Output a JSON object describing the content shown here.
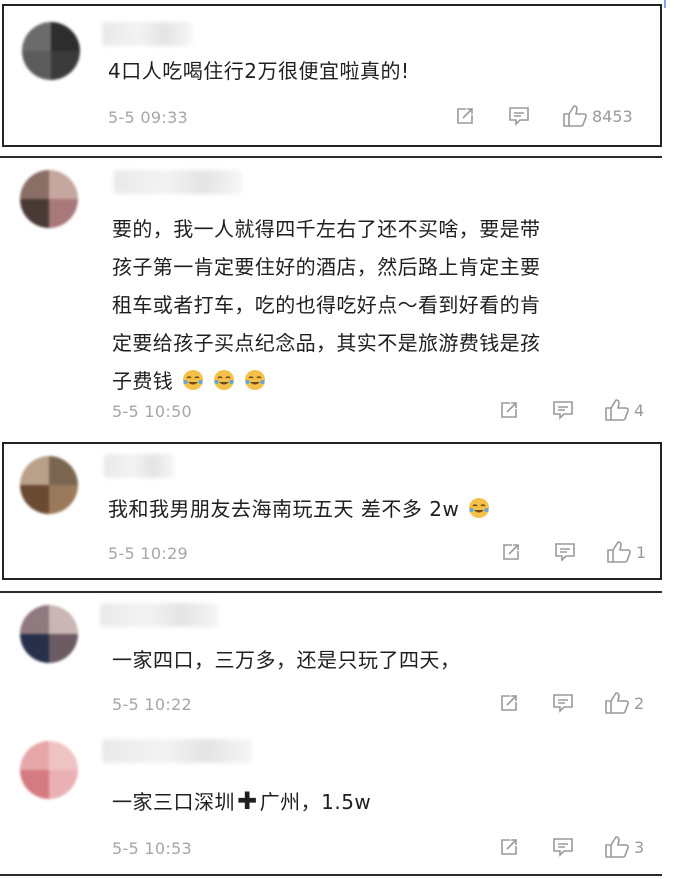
{
  "comments": [
    {
      "text": "4口人吃喝住行2万很便宜啦真的!",
      "time": "5-5 09:33",
      "likes": "8453"
    },
    {
      "lines": [
        "要的，我一人就得四千左右了还不买啥，要是带",
        "孩子第一肯定要住好的酒店，然后路上肯定主要",
        "租车或者打车，吃的也得吃好点～看到好看的肯",
        "定要给孩子买点纪念品，其实不是旅游费钱是孩",
        "子费钱"
      ],
      "emoji": "laugh-cry-emoji",
      "time": "5-5 10:50",
      "likes": "4"
    },
    {
      "text": "我和我男朋友去海南玩五天 差不多 2w",
      "emoji": "laugh-cry-emoji",
      "time": "5-5 10:29",
      "likes": "1"
    },
    {
      "text": "一家四口，三万多，还是只玩了四天，",
      "time": "5-5 10:22",
      "likes": "2"
    },
    {
      "text_before": "一家三口深圳",
      "text_after": "广州，1.5w",
      "plus_icon": "plus-icon",
      "time": "5-5 10:53",
      "likes": "3"
    }
  ],
  "icons": {
    "share": "share-icon",
    "reply": "comment-icon",
    "like": "thumbs-up-icon"
  },
  "colors": {
    "text": "#1f1f1f",
    "meta": "#a6a6a6",
    "border": "#222222",
    "emoji": "#f5c04a"
  }
}
